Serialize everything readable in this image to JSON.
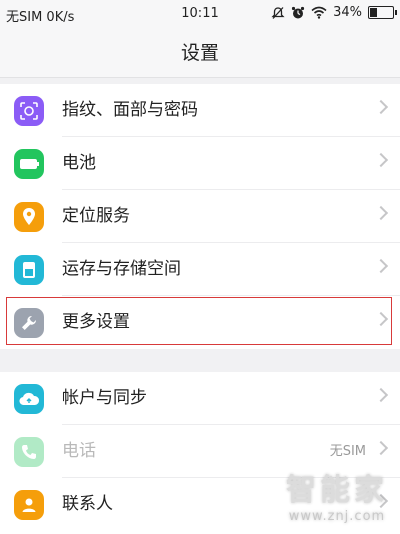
{
  "status_bar": {
    "carrier": "无SIM 0K/s",
    "time": "10:11",
    "battery": "34%",
    "battery_level": 0.34,
    "icons": [
      "mute-icon",
      "alarm-icon",
      "wifi-icon",
      "battery-icon"
    ]
  },
  "header": {
    "title": "设置"
  },
  "groups": [
    {
      "items": [
        {
          "label": "指纹、面部与密码",
          "icon": "fingerprint-face-icon",
          "color": "#8b5cf6"
        },
        {
          "label": "电池",
          "icon": "battery-icon",
          "color": "#22c55e"
        },
        {
          "label": "定位服务",
          "icon": "location-pin-icon",
          "color": "#f59e0b"
        },
        {
          "label": "运存与存储空间",
          "icon": "storage-icon",
          "color": "#22b8d6"
        },
        {
          "label": "更多设置",
          "icon": "wrench-icon",
          "color": "#9ca3af",
          "highlighted": true
        }
      ]
    },
    {
      "items": [
        {
          "label": "帐户与同步",
          "icon": "cloud-sync-icon",
          "color": "#22b8d6"
        },
        {
          "label": "电话",
          "icon": "phone-icon",
          "color": "#22c55e",
          "value": "无SIM",
          "disabled": true
        },
        {
          "label": "联系人",
          "icon": "contact-icon",
          "color": "#f59e0b"
        }
      ]
    }
  ],
  "watermark": {
    "title": "智能家",
    "url": "www.znj.com"
  }
}
